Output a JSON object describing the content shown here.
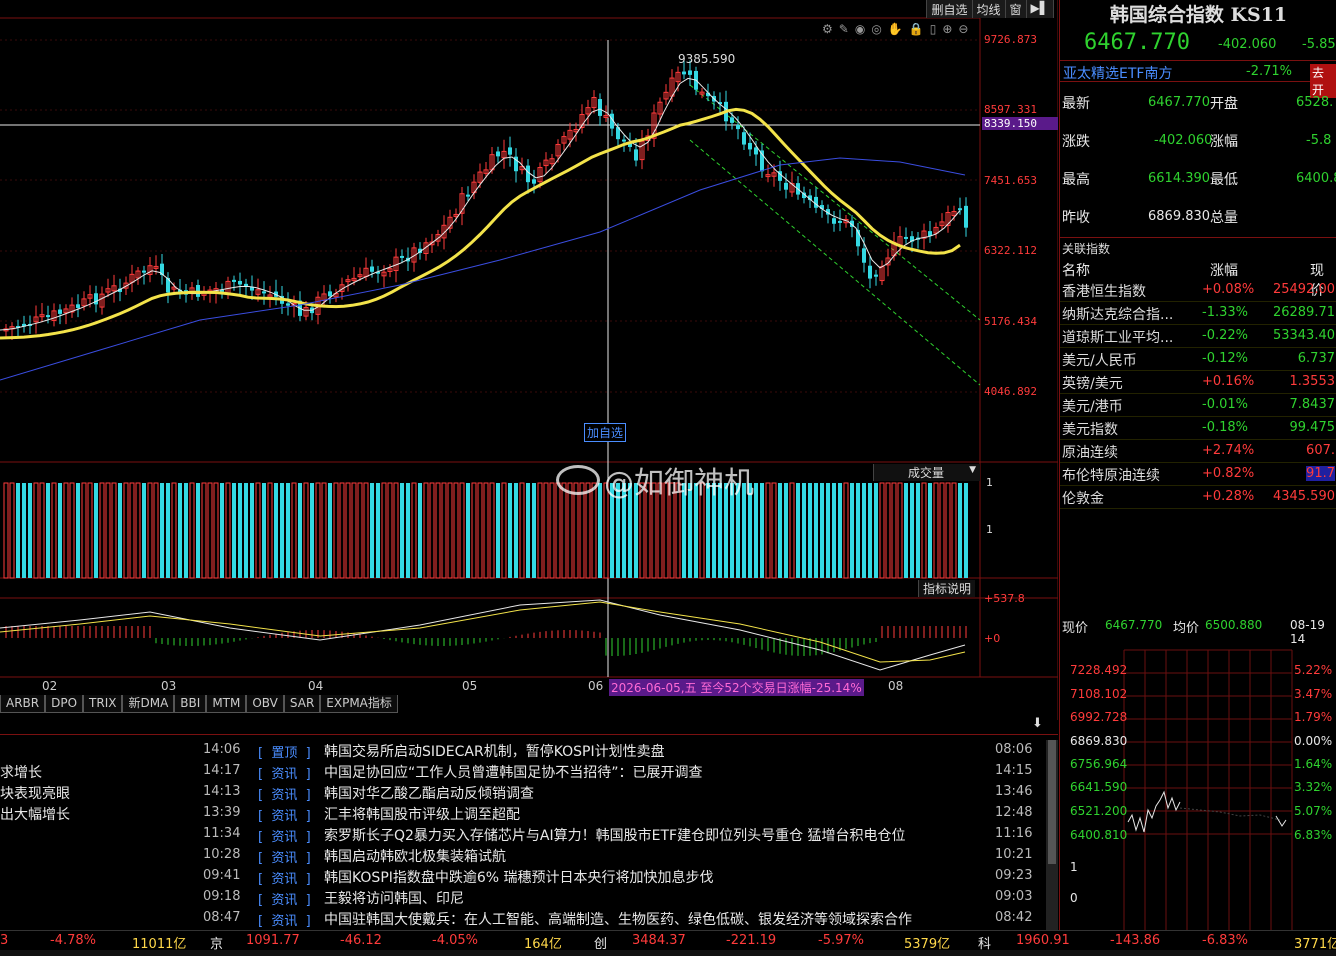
{
  "toolbar": {
    "del_watch": "删自选",
    "ma_line": "均线",
    "watch_icon": "窗",
    "jump_icon": "跳"
  },
  "chart": {
    "price_labels": [
      "9726.873",
      "8597.331",
      "8339.150",
      "7451.653",
      "6322.112",
      "5176.434",
      "4046.892"
    ],
    "peak_label": "9385.590",
    "add_watch": "加自选",
    "volume_title": "成交量",
    "volume_axis": [
      "1",
      "1"
    ],
    "indicator_help": "指标说明",
    "macd_axis": [
      "537.8",
      "0"
    ],
    "months": [
      "02",
      "03",
      "04",
      "05",
      "06",
      "08"
    ],
    "cursor_info": "2026-06-05,五 至今52个交易日涨幅-25.14%",
    "watermark": "@如御神机",
    "colors": {
      "up": "#ff3b3b",
      "down": "#34d9e3",
      "ma_yellow": "#f3e34a",
      "ma_blue": "#3a4de0",
      "channel": "#2fd22f"
    }
  },
  "indicator_tabs": [
    "ARBR",
    "DPO",
    "TRIX",
    "新DMA",
    "BBI",
    "MTM",
    "OBV",
    "SAR",
    "EXPMA指标"
  ],
  "news": {
    "left_items": [
      "求增长",
      "块表现亮眼",
      "出大幅增长"
    ],
    "rows": [
      {
        "time": "14:06",
        "tag": "置顶",
        "title": "韩国交易所启动SIDECAR机制，暂停KOSPI计划性卖盘",
        "time2": "08:06"
      },
      {
        "time": "14:17",
        "tag": "资讯",
        "title": "中国足协回应“工作人员曾遭韩国足协不当招待”：已展开调查",
        "time2": "14:15"
      },
      {
        "time": "14:13",
        "tag": "资讯",
        "title": "韩国对华乙酸乙酯启动反倾销调查",
        "time2": "13:46"
      },
      {
        "time": "13:39",
        "tag": "资讯",
        "title": "汇丰将韩国股市评级上调至超配",
        "time2": "12:48"
      },
      {
        "time": "11:34",
        "tag": "资讯",
        "title": "索罗斯长子Q2暴力买入存储芯片与AI算力！韩国股市ETF建仓即位列头号重仓 猛增台积电仓位",
        "time2": "11:16"
      },
      {
        "time": "10:28",
        "tag": "资讯",
        "title": "韩国启动韩欧北极集装箱试航",
        "time2": "10:21"
      },
      {
        "time": "09:41",
        "tag": "资讯",
        "title": "韩国KOSPI指数盘中跌逾6% 瑞穗预计日本央行将加快加息步伐",
        "time2": "09:23"
      },
      {
        "time": "09:18",
        "tag": "资讯",
        "title": "王毅将访问韩国、印尼",
        "time2": "09:03"
      },
      {
        "time": "08:47",
        "tag": "资讯",
        "title": "中国驻韩国大使戴兵：在人工智能、高端制造、生物医药、绿色低碳、银发经济等领域探索合作",
        "time2": "08:42"
      }
    ]
  },
  "quote": {
    "name": "韩国综合指数 KS11",
    "price": "6467.770",
    "change": "-402.060",
    "pct": "-5.85",
    "etf": "亚太精选ETF南方",
    "etf_pct": "-2.71%",
    "etf_btn": "去开",
    "latest_label": "最新",
    "latest": "6467.770",
    "open_label": "开盘",
    "open": "6528.",
    "chg_label": "涨跌",
    "chg": "-402.060",
    "amp_label": "涨幅",
    "amp": "-5.8",
    "high_label": "最高",
    "high": "6614.390",
    "low_label": "最低",
    "low": "6400.8",
    "prev_label": "昨收",
    "prev": "6869.830",
    "vol_label": "总量"
  },
  "related": {
    "title": "关联指数",
    "headers": [
      "名称",
      "涨幅",
      "现价"
    ],
    "rows": [
      {
        "name": "香港恒生指数",
        "chg": "+0.08%",
        "val": "25492.00",
        "up": true
      },
      {
        "name": "纳斯达克综合指...",
        "chg": "-1.33%",
        "val": "26289.71",
        "up": false
      },
      {
        "name": "道琼斯工业平均...",
        "chg": "-0.22%",
        "val": "53343.40",
        "up": false
      },
      {
        "name": "美元/人民币",
        "chg": "-0.12%",
        "val": "6.737",
        "up": false
      },
      {
        "name": "英镑/美元",
        "chg": "+0.16%",
        "val": "1.3553",
        "up": true
      },
      {
        "name": "美元/港币",
        "chg": "-0.01%",
        "val": "7.8437",
        "up": false
      },
      {
        "name": "美元指数",
        "chg": "-0.18%",
        "val": "99.475",
        "up": false
      },
      {
        "name": "原油连续",
        "chg": "+2.74%",
        "val": "607.",
        "up": true
      },
      {
        "name": "布伦特原油连续",
        "chg": "+0.82%",
        "val": "91.7",
        "up": true
      },
      {
        "name": "伦敦金",
        "chg": "+0.28%",
        "val": "4345.590",
        "up": true
      }
    ]
  },
  "intraday": {
    "now_label": "现价",
    "now": "6467.770",
    "avg_label": "均价",
    "avg": "6500.880",
    "date": "08-19 14",
    "left_axis": [
      "7228.492",
      "7108.102",
      "6992.728",
      "6869.830",
      "6756.964",
      "6641.590",
      "6521.200",
      "6400.810",
      "1",
      "0"
    ],
    "right_axis": [
      "5.22%",
      "3.47%",
      "1.79%",
      "0.00%",
      "1.64%",
      "3.32%",
      "5.07%",
      "6.83%"
    ]
  },
  "status": {
    "s1": "-4.78%",
    "s2": "11011亿",
    "s3": "京",
    "s4": "1091.77",
    "s5": "-46.12",
    "s6": "-4.05%",
    "s7": "164亿",
    "s8": "创",
    "s9": "3484.37",
    "s10": "-221.19",
    "s11": "-5.97%",
    "s12": "5379亿",
    "s13": "科",
    "s14": "1960.91",
    "s15": "-143.86",
    "s16": "-6.83%",
    "s17": "3771亿"
  }
}
